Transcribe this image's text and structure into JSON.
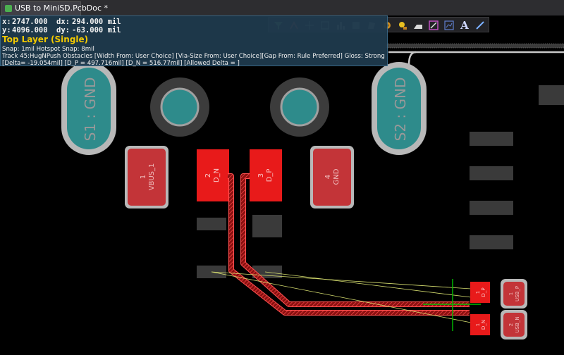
{
  "document_tab": {
    "title": "USB to MiniSD.PcbDoc *"
  },
  "hud": {
    "x_label": "x:",
    "x_value": "2747.000",
    "dx_label": "dx:",
    "dx_value": "294.000 mil",
    "y_label": "y:",
    "y_value": "4096.000",
    "dy_label": "dy:",
    "dy_value": "-63.000  mil",
    "layer": "Top Layer (Single)",
    "snap": "Snap: 1mil Hotspot Snap: 8mil",
    "track": "Track 45:HugNPush Obstacles [Width From: User Choice]  [Via-Size From: User Choice][Gap From: Rule Preferred] Gloss: Strong",
    "delta": "[Delta= -19.054mil] [D_P = 497.716mil] [D_N = 516.77mil] [Allowed Delta = ]"
  },
  "pads": {
    "s1": "S1 : GND",
    "s2": "S2 : GND",
    "p1_num": "1",
    "p1_net": "VBUS_1",
    "p2_num": "2",
    "p2_net": "D_N",
    "p3_num": "3",
    "p3_net": "D_P",
    "p4_num": "4",
    "p4_net": "GND",
    "r1_num": "1",
    "r1_net": "D_P",
    "r2_num": "1",
    "r2_net": "D_N",
    "c1_num": "1",
    "c1_net": "USB_P",
    "c2_num": "2",
    "c2_net": "USB_N"
  },
  "toolbar": {
    "icons": [
      "filter-icon",
      "route-icon",
      "crosshair-icon",
      "rectangle-icon",
      "bar-chart-icon",
      "component-icon",
      "polygon-icon",
      "via-icon",
      "pad-icon",
      "region-icon",
      "image-icon",
      "graph-icon",
      "text-icon",
      "line-icon"
    ],
    "text_glyph": "A"
  },
  "colors": {
    "board_bg": "#000000",
    "pad_red": "#e81a1a",
    "track_red": "#d81616",
    "pad_grey": "#7a7a7a",
    "teal": "#2e8b8b",
    "hud_bg": "#1f3a4d",
    "hud_layer": "#ffd400",
    "ratsnest": "#d8e070",
    "guide_green": "#00c000"
  }
}
